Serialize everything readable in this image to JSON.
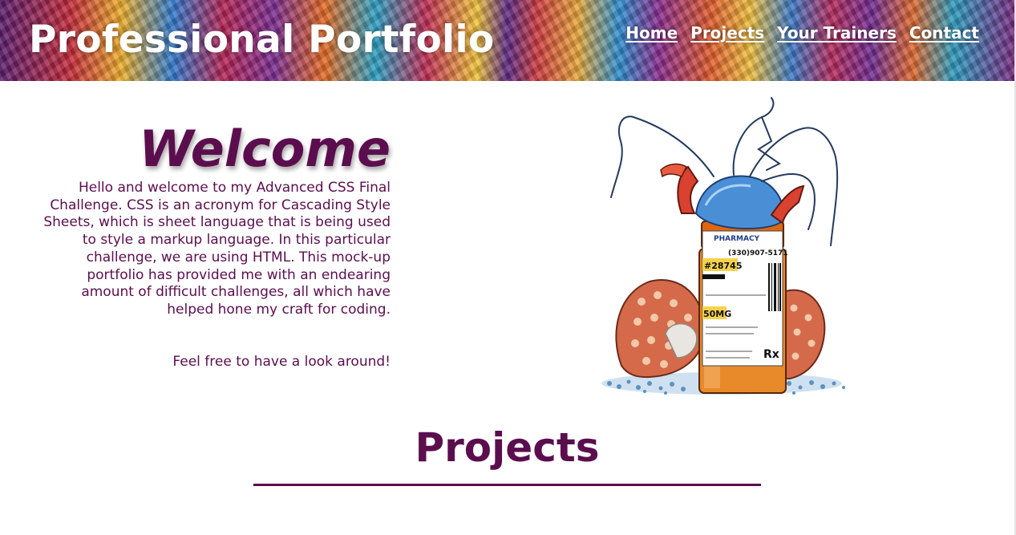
{
  "header": {
    "title": "Professional Portfolio",
    "nav": [
      {
        "label": "Home"
      },
      {
        "label": "Projects"
      },
      {
        "label": "Your Trainers"
      },
      {
        "label": "Contact"
      }
    ]
  },
  "welcome": {
    "heading": "Welcome",
    "intro": "Hello and welcome to my Advanced CSS Final Challenge. CSS is an acronym for Cascading Style Sheets, which is sheet language that is being used to style a markup language. In this particular challenge, we are using HTML. This mock-up portfolio has provided me with an endearing amount of difficult challenges, all which have helped hone my craft for coding.",
    "outro": "Feel free to have a look around!"
  },
  "hero_image": {
    "icon": "hermit-crab-pill-bottle-illustration",
    "label_lines": [
      "PHARMACY",
      "(330)907-5171",
      "#28745",
      "50MG",
      "Rx"
    ]
  },
  "projects": {
    "heading": "Projects"
  },
  "colors": {
    "accent": "#5b0e4e",
    "header_text": "#ffffff",
    "background": "#ffffff"
  }
}
